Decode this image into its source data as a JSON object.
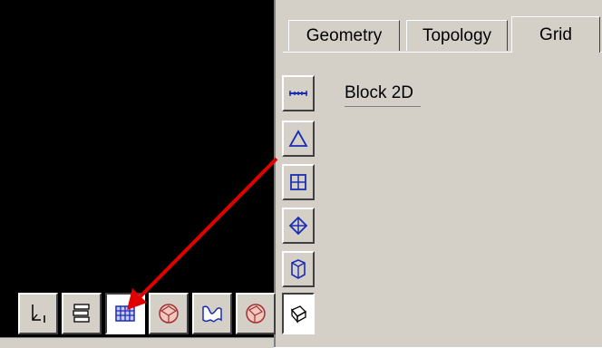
{
  "tabs": [
    {
      "label": "Geometry",
      "active": false
    },
    {
      "label": "Topology",
      "active": false
    },
    {
      "label": "Grid",
      "active": true
    }
  ],
  "side_toolbar": {
    "items": [
      {
        "icon": "edge-params-icon"
      },
      {
        "icon": "triangle-icon"
      },
      {
        "icon": "quad-grid-icon"
      },
      {
        "icon": "diamond-icon"
      },
      {
        "icon": "cube-volume-icon"
      },
      {
        "icon": "block-mesh-icon",
        "active": true
      }
    ]
  },
  "block_panel": {
    "label": "Block 2D"
  },
  "bottom_toolbar": {
    "items": [
      {
        "icon": "axis-icon"
      },
      {
        "icon": "layers-icon"
      },
      {
        "icon": "grid-mesh-icon",
        "active": true
      },
      {
        "icon": "shaded-sphere-icon"
      },
      {
        "icon": "curve-icon"
      },
      {
        "icon": "shaded-cube-icon"
      }
    ]
  },
  "colors": {
    "panel": "#d4d0c8",
    "viewport": "#000000",
    "arrow": "#e00000",
    "icon_blue": "#1a2db0",
    "icon_red": "#c04040"
  }
}
